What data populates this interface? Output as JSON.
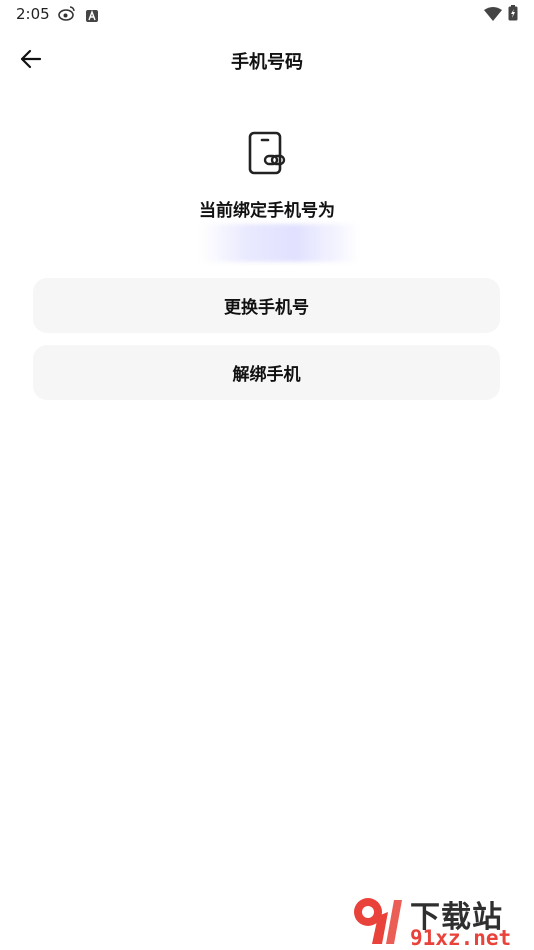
{
  "status_bar": {
    "time": "2:05",
    "icons": [
      "weibo-icon",
      "notification-a-icon",
      "wifi-icon",
      "battery-charging-icon"
    ]
  },
  "header": {
    "title": "手机号码",
    "back_icon": "arrow-left-icon"
  },
  "main": {
    "icon": "phone-link-icon",
    "bound_label": "当前绑定手机号为",
    "buttons": {
      "change": "更换手机号",
      "unbind": "解绑手机"
    }
  },
  "watermark": {
    "title": "下载站",
    "url": "91xz.net",
    "accent_color": "#e8423a"
  }
}
